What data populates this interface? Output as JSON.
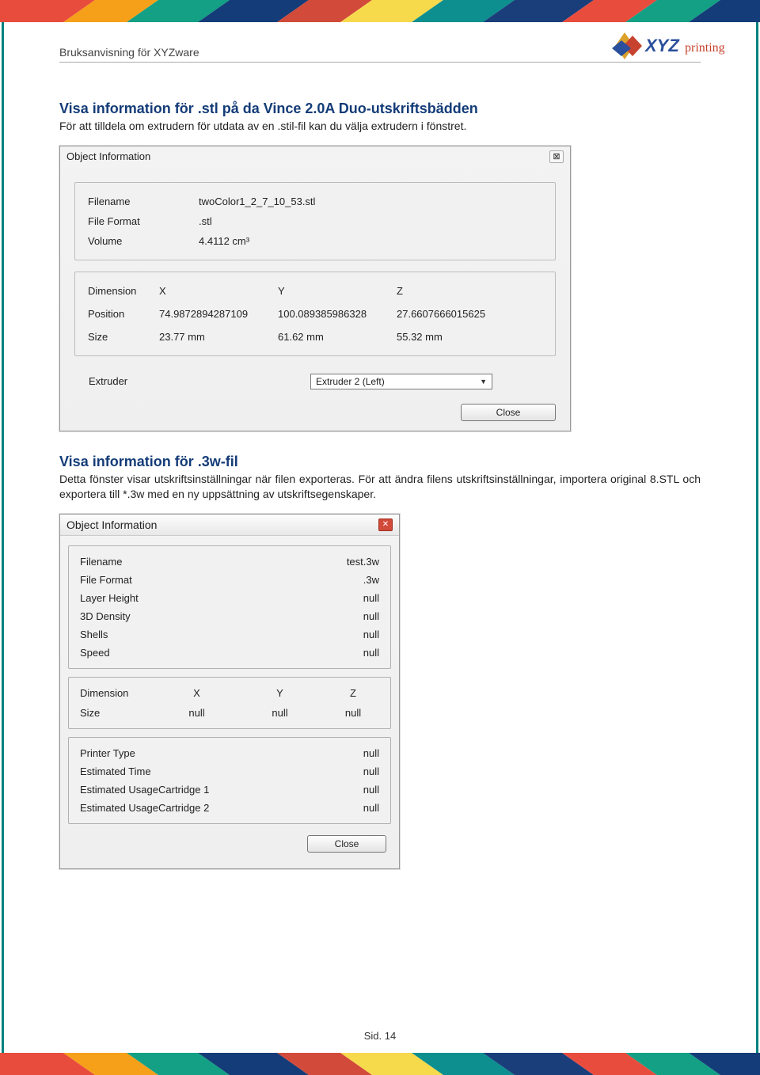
{
  "header": {
    "doc_title": "Bruksanvisning för XYZware",
    "logo_text": "XYZprinting"
  },
  "section1": {
    "title": "Visa information för .stl på da Vince 2.0A Duo-utskriftsbädden",
    "body": "För att tilldela om extrudern för utdata av en .stil-fil kan du välja extrudern i fönstret."
  },
  "dialog1": {
    "title": "Object Information",
    "labels": {
      "filename": "Filename",
      "fileformat": "File Format",
      "volume": "Volume",
      "dimension": "Dimension",
      "position": "Position",
      "size": "Size",
      "extruder": "Extruder",
      "x": "X",
      "y": "Y",
      "z": "Z"
    },
    "values": {
      "filename": "twoColor1_2_7_10_53.stl",
      "fileformat": ".stl",
      "volume": "4.4112 cm³",
      "pos_x": "74.9872894287109",
      "pos_y": "100.089385986328",
      "pos_z": "27.6607666015625",
      "size_x": "23.77 mm",
      "size_y": "61.62 mm",
      "size_z": "55.32 mm",
      "extruder_selected": "Extruder 2 (Left)"
    },
    "close_btn": "Close"
  },
  "section2": {
    "title": "Visa information för .3w-fil",
    "body": "Detta fönster visar utskriftsinställningar när filen exporteras. För att ändra filens utskriftsinställningar, importera original 8.STL och exportera till *.3w med en ny uppsättning av utskriftsegenskaper."
  },
  "dialog2": {
    "title": "Object Information",
    "labels": {
      "filename": "Filename",
      "fileformat": "File Format",
      "layerheight": "Layer Height",
      "density": "3D Density",
      "shells": "Shells",
      "speed": "Speed",
      "dimension": "Dimension",
      "size": "Size",
      "x": "X",
      "y": "Y",
      "z": "Z",
      "printertype": "Printer Type",
      "esttime": "Estimated Time",
      "cart1": "Estimated UsageCartridge 1",
      "cart2": "Estimated UsageCartridge 2"
    },
    "values": {
      "filename": "test.3w",
      "fileformat": ".3w",
      "layerheight": "null",
      "density": "null",
      "shells": "null",
      "speed": "null",
      "size_x": "null",
      "size_y": "null",
      "size_z": "null",
      "printertype": "null",
      "esttime": "null",
      "cart1": "null",
      "cart2": "null"
    },
    "close_btn": "Close"
  },
  "footer": {
    "page": "Sid. 14"
  },
  "banner_colors": [
    "#e84c3d",
    "#f6a01a",
    "#13a085",
    "#143c78",
    "#d24a3a",
    "#f7d94c",
    "#0e8f8f",
    "#1a3e7a",
    "#e84c3d",
    "#f6a01a",
    "#13a085",
    "#143c78"
  ]
}
